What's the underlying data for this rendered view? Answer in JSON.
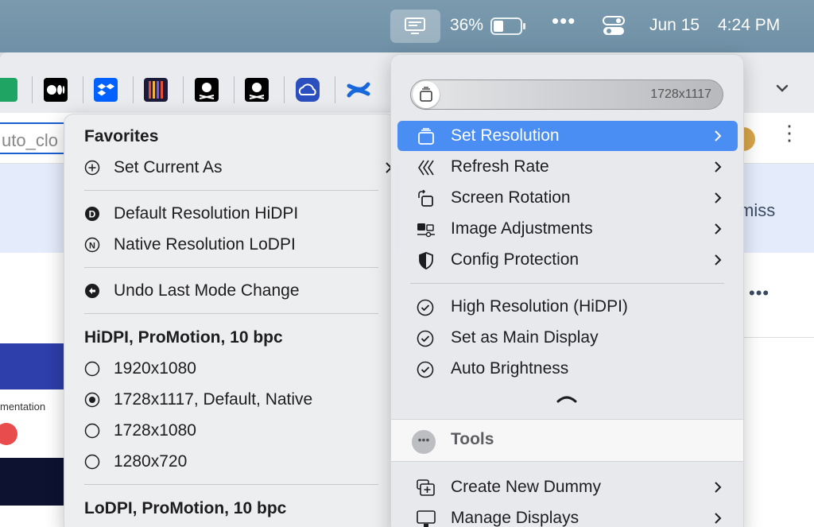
{
  "menubar": {
    "battery_percent": "36%",
    "battery_level": 0.36,
    "more_glyph": "•••",
    "date": "Jun 15",
    "time": "4:24 PM"
  },
  "browser": {
    "address_text": "uto_clo",
    "banner_dismiss": "miss",
    "more_dots": "•••",
    "kebab": "⋮",
    "partial_text": "mentation",
    "bookmark_icons": [
      "google-sheets-icon",
      "medium-icon",
      "dropbox-icon",
      "bookmark-icon",
      "app-icon",
      "app-icon",
      "cloud-icon",
      "confluence-icon"
    ]
  },
  "submenu": {
    "favorites_header": "Favorites",
    "set_current_as": "Set Current As",
    "default_resolution": "Default Resolution HiDPI",
    "native_resolution": "Native Resolution LoDPI",
    "undo_last": "Undo Last Mode Change",
    "hidpi_header": "HiDPI, ProMotion, 10 bpc",
    "resolutions": [
      {
        "label": "1920x1080",
        "selected": false
      },
      {
        "label": "1728x1117, Default, Native",
        "selected": true
      },
      {
        "label": "1728x1080",
        "selected": false
      },
      {
        "label": "1280x720",
        "selected": false
      }
    ],
    "lodpi_header": "LoDPI, ProMotion, 10 bpc"
  },
  "mainmenu": {
    "resolution_value": "1728x1117",
    "items": [
      {
        "label": "Set Resolution",
        "icon": "resolution-icon"
      },
      {
        "label": "Refresh Rate",
        "icon": "refresh-rate-icon"
      },
      {
        "label": "Screen Rotation",
        "icon": "rotation-icon"
      },
      {
        "label": "Image Adjustments",
        "icon": "adjustments-icon"
      },
      {
        "label": "Config Protection",
        "icon": "shield-icon"
      }
    ],
    "toggles": [
      {
        "label": "High Resolution (HiDPI)",
        "checked": true
      },
      {
        "label": "Set as Main Display",
        "checked": true
      },
      {
        "label": "Auto Brightness",
        "checked": true
      }
    ],
    "tools_label": "Tools",
    "tools_glyph": "•••",
    "tool_items": [
      {
        "label": "Create New Dummy",
        "icon": "dummy-icon"
      },
      {
        "label": "Manage Displays",
        "icon": "display-icon"
      }
    ]
  },
  "colors": {
    "highlight": "#4a8ef4",
    "menubar": "#7396ab"
  }
}
